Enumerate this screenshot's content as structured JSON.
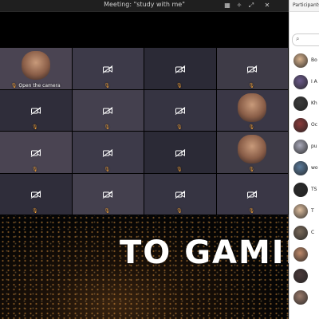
{
  "window": {
    "title": "Meeting: \"study with me\"",
    "controls": [
      "grid-view-icon",
      "pin-icon",
      "fullscreen-icon",
      "close-icon"
    ]
  },
  "tiles": [
    {
      "name": "Ọpen the camera",
      "video": true
    },
    {
      "name": "",
      "video": false
    },
    {
      "name": "",
      "video": false
    },
    {
      "name": "",
      "video": false
    },
    {
      "name": "",
      "video": false
    },
    {
      "name": "",
      "video": false
    },
    {
      "name": "",
      "video": false
    },
    {
      "name": "",
      "video": true
    },
    {
      "name": "",
      "video": false
    },
    {
      "name": "",
      "video": false
    },
    {
      "name": "",
      "video": false
    },
    {
      "name": "",
      "video": true
    },
    {
      "name": "",
      "video": false
    },
    {
      "name": "",
      "video": false
    },
    {
      "name": "",
      "video": false
    },
    {
      "name": "",
      "video": false
    }
  ],
  "wallpaper": {
    "text": "TO GAMIN"
  },
  "participants": {
    "header": "Participants",
    "items": [
      {
        "name": "Bo"
      },
      {
        "name": "I A"
      },
      {
        "name": "Kh"
      },
      {
        "name": "Oc"
      },
      {
        "name": "pu"
      },
      {
        "name": "wo"
      },
      {
        "name": "TS"
      },
      {
        "name": "T"
      },
      {
        "name": "C"
      },
      {
        "name": ""
      },
      {
        "name": ""
      },
      {
        "name": ""
      }
    ]
  }
}
